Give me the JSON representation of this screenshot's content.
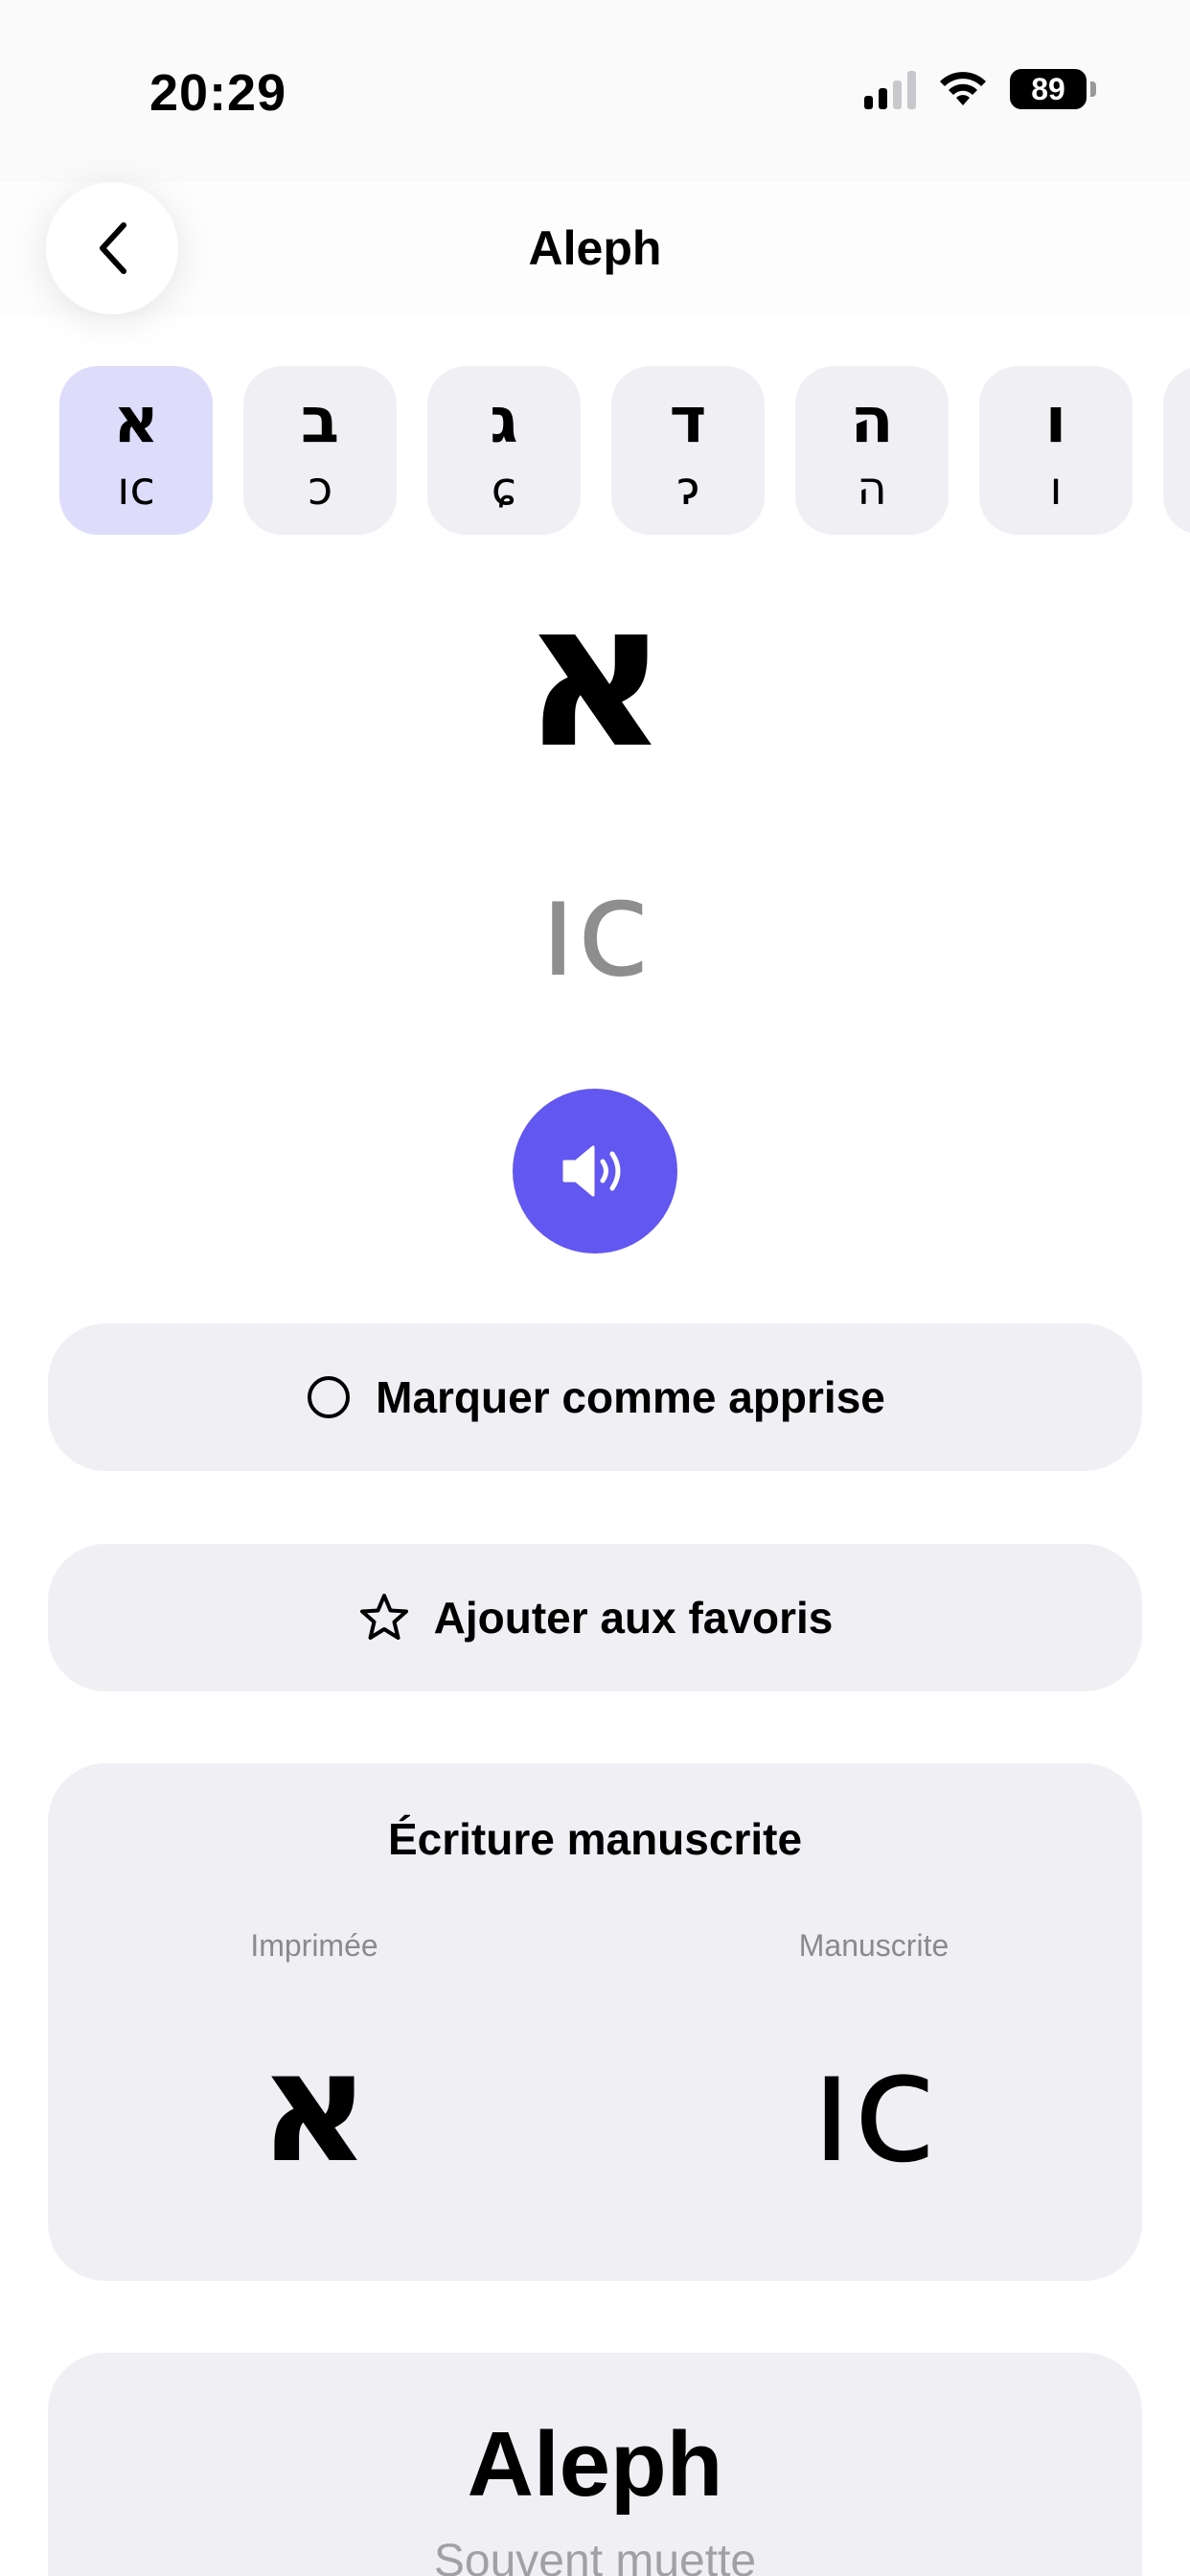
{
  "status": {
    "time": "20:29",
    "battery": "89"
  },
  "nav": {
    "title": "Aleph"
  },
  "letters": [
    {
      "printed": "א",
      "script": "ıc",
      "selected": true
    },
    {
      "printed": "ב",
      "script": "ɔ",
      "selected": false
    },
    {
      "printed": "ג",
      "script": "ɕ",
      "selected": false
    },
    {
      "printed": "ד",
      "script": "ɂ",
      "selected": false
    },
    {
      "printed": "ה",
      "script": "ה",
      "selected": false
    },
    {
      "printed": "ו",
      "script": "ı",
      "selected": false
    }
  ],
  "hero": {
    "printed": "א",
    "script": "ıc"
  },
  "actions": {
    "learned_label": "Marquer comme apprise",
    "favorite_label": "Ajouter aux favoris"
  },
  "handwriting": {
    "title": "Écriture manuscrite",
    "printed_label": "Imprimée",
    "script_label": "Manuscrite",
    "printed_glyph": "א",
    "script_glyph": "ıc"
  },
  "name_card": {
    "title": "Aleph",
    "subtitle": "Souvent muette"
  },
  "colors": {
    "accent": "#6257f0",
    "chip_active": "#dedcfb",
    "surface": "#f0f0f4"
  }
}
